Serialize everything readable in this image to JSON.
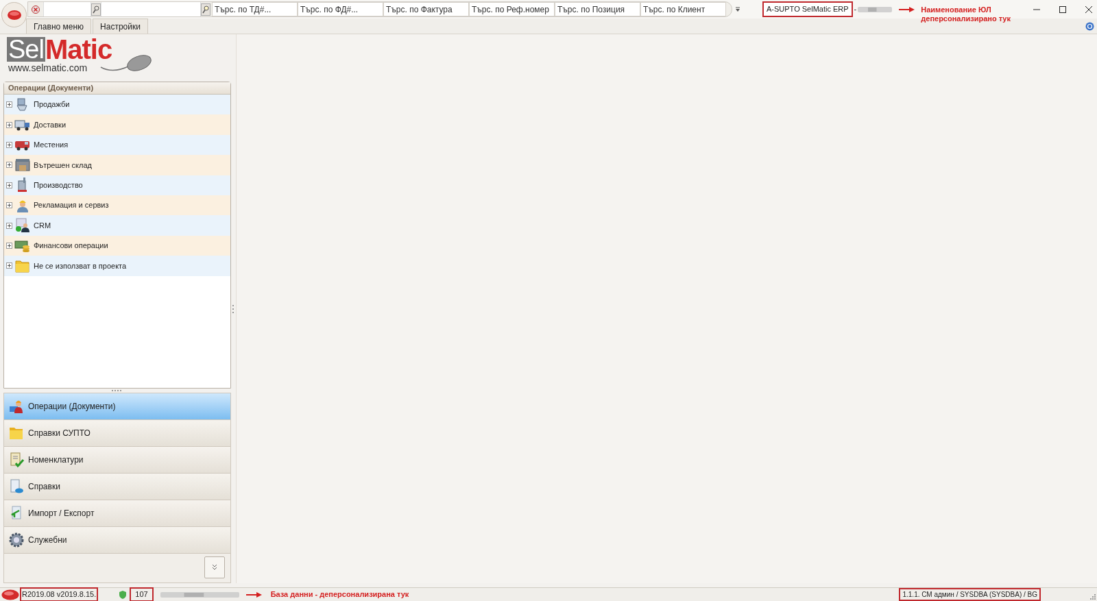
{
  "window": {
    "title": "A-SUPTO SelMatic ERP",
    "title_separator": "-"
  },
  "search_fields": [
    {
      "placeholder": "Търс. по ТД#..."
    },
    {
      "placeholder": "Търс. по ФД#..."
    },
    {
      "placeholder": "Търс. по Фактура"
    },
    {
      "placeholder": "Търс. по Реф.номер"
    },
    {
      "placeholder": "Търс. по Позиция"
    },
    {
      "placeholder": "Търс. по Клиент"
    }
  ],
  "tabs": [
    {
      "label": "Главно меню",
      "selected": false
    },
    {
      "label": "Настройки",
      "selected": false
    }
  ],
  "logo": {
    "brand_left": "Sel",
    "brand_right": "Matic",
    "url": "www.selmatic.com"
  },
  "tree": {
    "header": "Операции (Документи)",
    "items": [
      {
        "label": "Продажби",
        "expanded": false
      },
      {
        "label": "Доставки",
        "expanded": false
      },
      {
        "label": "Местения",
        "expanded": false
      },
      {
        "label": "Вътрешен склад",
        "expanded": false
      },
      {
        "label": "Производство",
        "expanded": false
      },
      {
        "label": "Рекламация и сервиз",
        "expanded": false
      },
      {
        "label": "CRM",
        "expanded": false
      },
      {
        "label": "Финансови операции",
        "expanded": false
      },
      {
        "label": "Не се използват в проекта",
        "expanded": false
      }
    ]
  },
  "nav": [
    {
      "label": "Операции (Документи)",
      "selected": true
    },
    {
      "label": "Справки СУПТО",
      "selected": false
    },
    {
      "label": "Номенклатури",
      "selected": false
    },
    {
      "label": "Справки",
      "selected": false
    },
    {
      "label": "Импорт / Експорт",
      "selected": false
    },
    {
      "label": "Служебни",
      "selected": false
    }
  ],
  "status_bar": {
    "version": "R2019.08 v2019.8.15.",
    "count": "107",
    "user": "1.1.1. СМ админ / SYSDBA (SYSDBA) / BG"
  },
  "annotations": [
    {
      "text": "Наименование ЮЛ деперсонализирано тук"
    },
    {
      "text": "База данни - деперсонализирана тук"
    }
  ]
}
